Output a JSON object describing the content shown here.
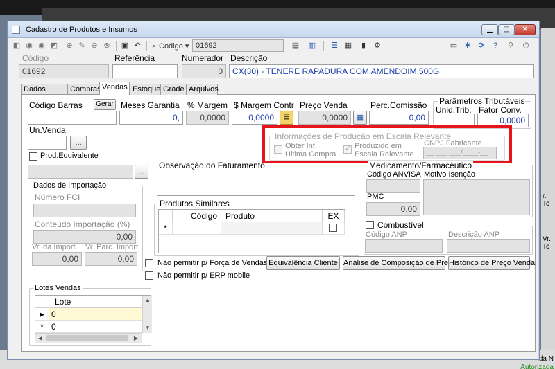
{
  "background": {
    "right_labels": [
      "r. Tc",
      "Vr. Tc"
    ],
    "status_text": "ida N",
    "status_green": "Autorizada"
  },
  "window": {
    "title": "Cadastro de Produtos e Insumos",
    "min_label": "▁",
    "max_label": "▢",
    "close_label": "✕"
  },
  "toolbar": {
    "code_label": "Codigo",
    "code_value": "01692"
  },
  "header": {
    "codigo_label": "Código",
    "codigo_value": "01692",
    "referencia_label": "Referência",
    "referencia_value": "",
    "numerador_label": "Numerador",
    "numerador_value": "0",
    "descricao_label": "Descrição",
    "descricao_value": "CX(30) - TENERE RAPADURA COM AMENDOIM 500G"
  },
  "tabs": [
    "Dados Gerais",
    "Compras",
    "Vendas",
    "Estoque",
    "Grade",
    "Arquivos"
  ],
  "vendas": {
    "codigo_barras_label": "Código Barras",
    "gerar_label": "Gerar",
    "meses_garantia_label": "Meses Garantia",
    "meses_garantia_value": "0,",
    "margem_label": "% Margem",
    "margem_value": "0,0000",
    "margem_contr_label": "$ Margem Contr",
    "margem_contr_value": "0,0000",
    "preco_venda_label": "Preço Venda",
    "preco_venda_value": "0,0000",
    "perc_comissao_label": "Perc.Comissão",
    "perc_comissao_value": "0,00",
    "param_trib_label": "Parâmetros Tributáveis",
    "unid_trib_label": "Unid.Trib.",
    "fator_conv_label": "Fator Conv.",
    "fator_conv_value": "0,0000",
    "un_venda_label": "Un.Venda",
    "ellipsis": "...",
    "prod_equivalente_label": "Prod.Equivalente",
    "escala_title": "Informações de Produção em Escala Relevante",
    "obter_inf_label": "Obter Inf.",
    "ultima_compra_label": "Ultima Compra",
    "produzido_label": "Produzido em",
    "escala_relevante_label": "Escala Relevante",
    "cnpj_label": "CNPJ Fabricante",
    "cnpj_value": "__.___.___/____-__",
    "importacao_title": "Dados de Importação",
    "numero_fci_label": "Número FCI",
    "conteudo_imp_label": "Conteúdo Importação (%)",
    "conteudo_imp_value": "0,00",
    "vr_import_label": "Vr. da Import.",
    "vr_import_value": "0,00",
    "vr_parc_label": "Vr. Parc. Import.",
    "vr_parc_value": "0,00",
    "obs_faturamento_label": "Observação do Faturamento",
    "similares_title": "Produtos Similares",
    "similares_cols": [
      "Código",
      "Produto",
      "EX"
    ],
    "new_row_marker": "*",
    "medicamento_title": "Medicamento/Farmacêutico",
    "codigo_anvisa_label": "Código ANVISA",
    "motivo_isencao_label": "Motivo Isenção",
    "pmc_label": "PMC",
    "pmc_value": "0,00",
    "combustivel_label": "Combustível",
    "codigo_anp_label": "Código ANP",
    "descricao_anp_label": "Descrição ANP",
    "nao_forca_label": "Não permitir p/ Força de Vendas",
    "nao_erp_label": "Não permitir p/ ERP mobile",
    "equivalencia_btn": "Equivalência Cliente",
    "analise_btn": "Análise de Composição de Preço",
    "historico_btn": "Histórico de Preço Venda",
    "lotes_title": "Lotes Vendas",
    "lote_col": "Lote",
    "lote_rows": [
      {
        "marker": "▶",
        "value": "0"
      },
      {
        "marker": "*",
        "value": "0"
      }
    ]
  }
}
